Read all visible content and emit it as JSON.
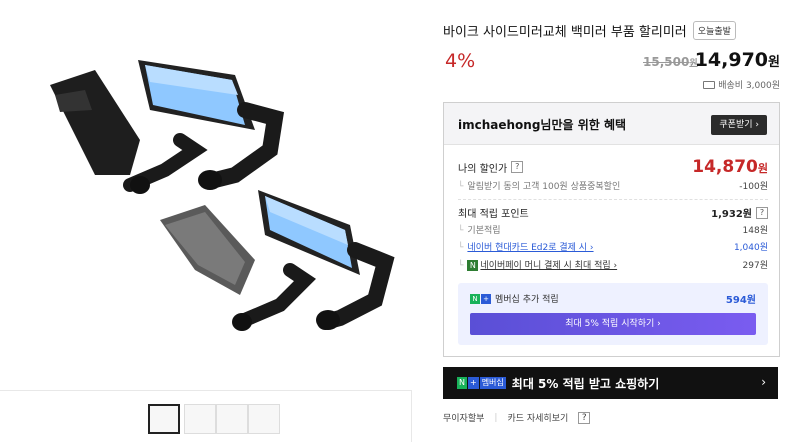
{
  "product": {
    "title": "바이크 사이드미러교체 백미러 부품 할리미러",
    "badge": "오늘출발",
    "discount": "4%",
    "original_price": "15,500",
    "original_unit": "원",
    "sale_price": "14,970",
    "sale_unit": "원",
    "shipping": "배송비 3,000원"
  },
  "benefit": {
    "title": "imchaehong님만을 위한 혜택",
    "coupon_button": "쿠폰받기 ›",
    "my_price_label": "나의 할인가",
    "my_price": "14,870",
    "my_price_unit": "원",
    "alert_label": "알림받기 동의 고객 100원 상품중복할인",
    "alert_value": "-100원",
    "points_label": "최대 적립 포인트",
    "points_value": "1,932원",
    "basic_label": "기본적립",
    "basic_value": "148원",
    "card_label": "네이버 현대카드 Ed2로 결제 시 ›",
    "card_value": "1,040원",
    "money_label": "네이버페이 머니 결제 시 최대 적립 ›",
    "money_value": "297원",
    "membership_label": "멤버십 추가 적립",
    "membership_value": "594원",
    "membership_button": "최대 5% 적립 시작하기 ›"
  },
  "banner": {
    "tag_n": "N",
    "tag_plus": "+",
    "tag_text": "멤버십",
    "text": "최대 5% 적립 받고 쇼핑하기",
    "arrow": "›"
  },
  "footer": {
    "item1": "무이자할부",
    "item2": "카드 자세히보기"
  },
  "colors": {
    "discount_red": "#c62828",
    "link_blue": "#2b5bd7",
    "membership_purple": "#6a56e6",
    "banner_black": "#111111"
  },
  "icons": {
    "truck": "truck-icon",
    "help": "question-icon",
    "npay": "npay-icon"
  }
}
